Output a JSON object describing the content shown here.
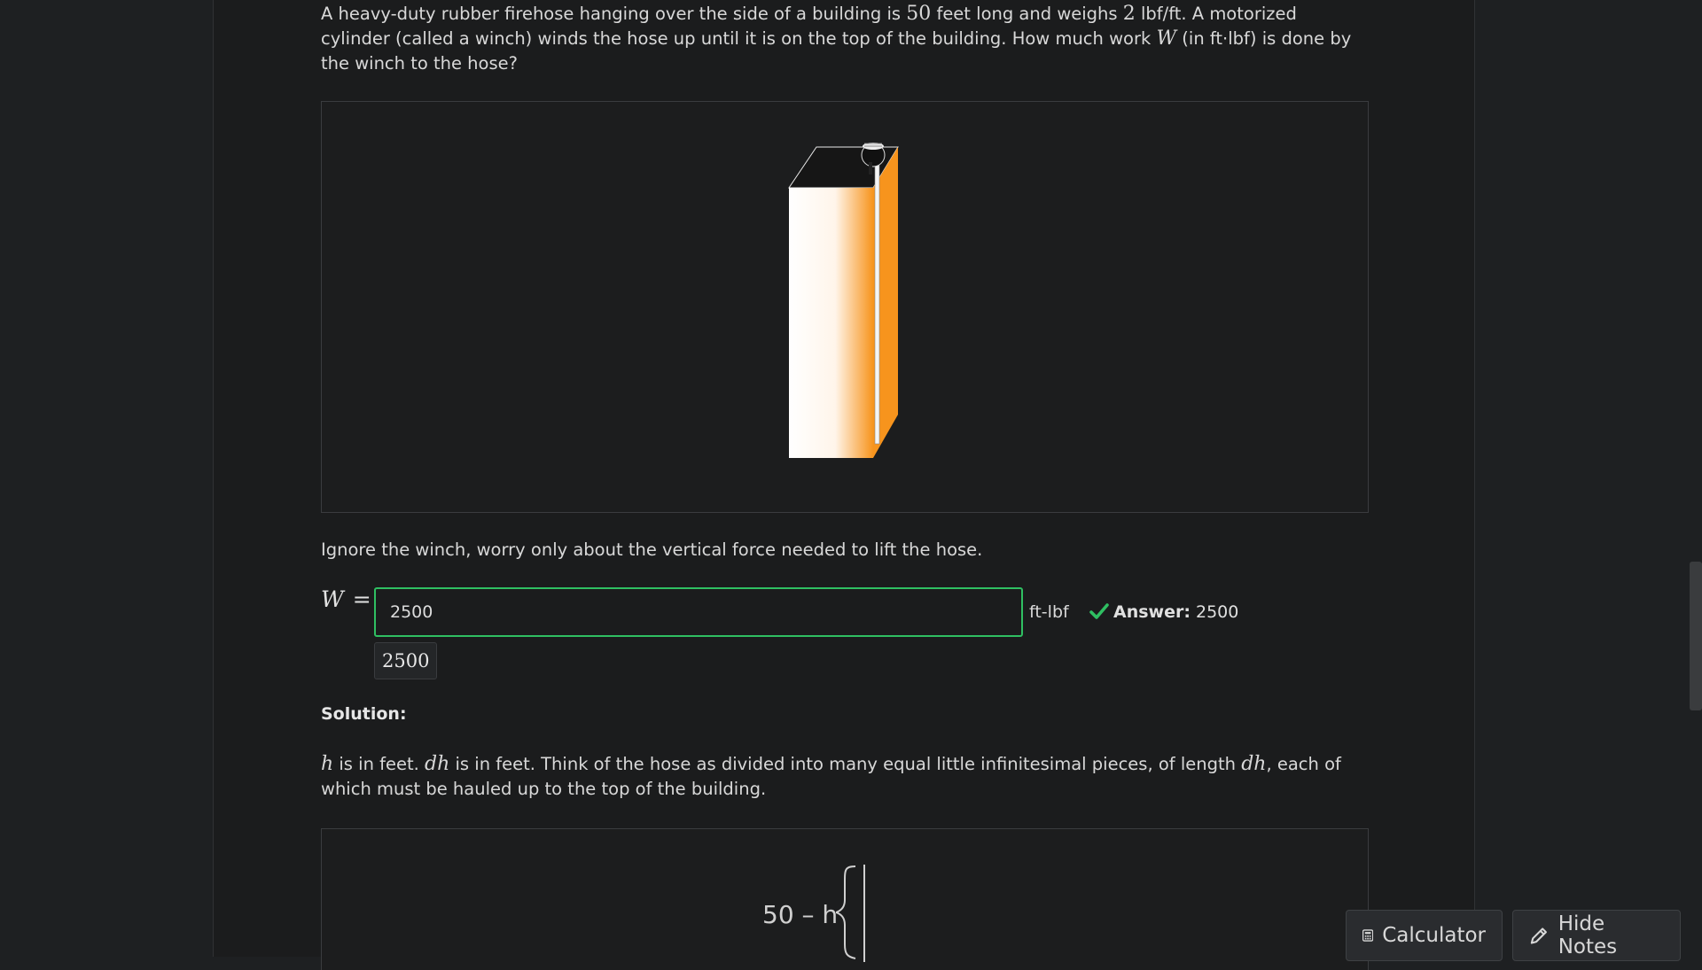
{
  "problem": {
    "p1": "A heavy-duty rubber firehose hanging over the side of a building is ",
    "len": "50",
    "p2": " feet long and weighs ",
    "weight": "2",
    "p3": " lbf/ft. A motorized cylinder (called a winch) winds the hose up until it is on the top of the building. How much work ",
    "w": "W",
    "p4": " (in ft·lbf) is done by the winch to the hose?"
  },
  "instruction": "Ignore the winch, worry only about the vertical force needed to lift the hose.",
  "answer": {
    "label": "W",
    "equals": "=",
    "value": "2500",
    "unit": "ft-lbf",
    "feedback_label": "Answer:",
    "feedback_value": "2500",
    "preview": "2500"
  },
  "solution": {
    "heading": "Solution:",
    "h": "h",
    "t1": " is in feet. ",
    "dh": "dh",
    "t2": " is in feet. Think of the hose as divided into many equal little infinitesimal pieces, of length ",
    "dh2": "dh",
    "t3": ", each of which must be hauled up to the top of the building.",
    "figure_label": "50 – h"
  },
  "buttons": {
    "calculator": "Calculator",
    "hide_notes": "Hide Notes"
  },
  "colors": {
    "accent_green": "#2fbf62",
    "building_orange": "#f7941d"
  }
}
